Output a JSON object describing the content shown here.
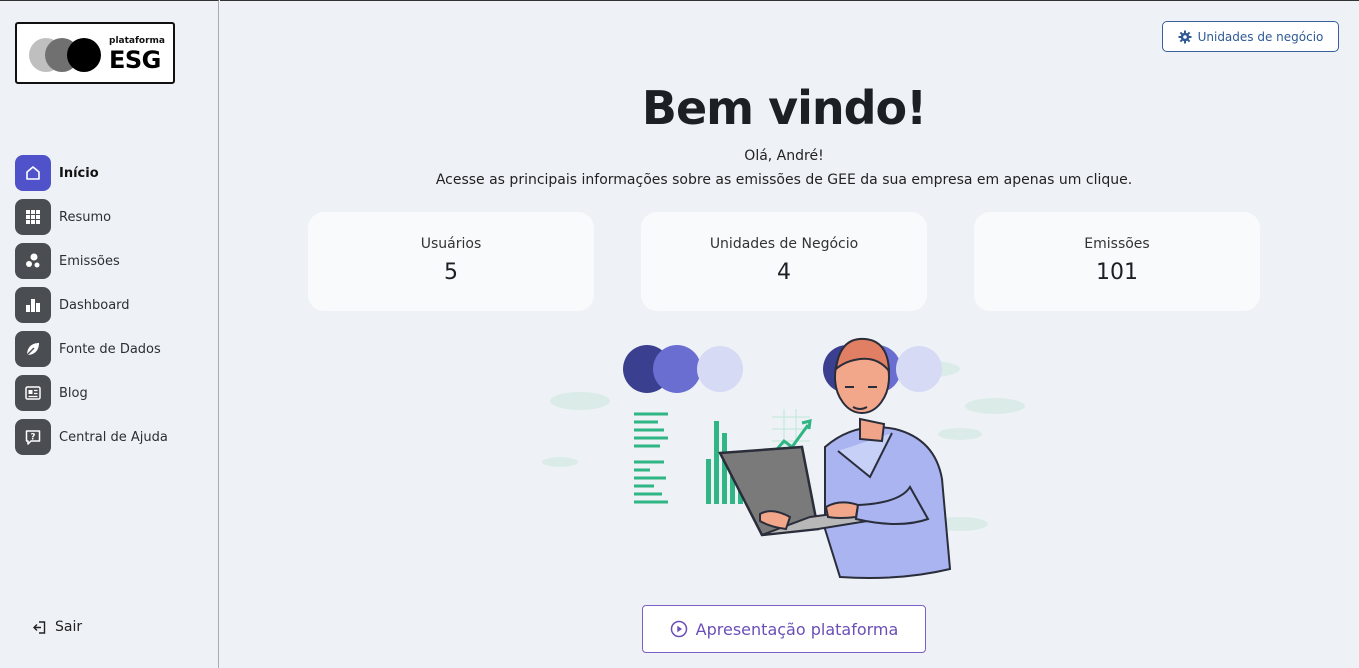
{
  "logo": {
    "small": "plataforma",
    "big": "ESG"
  },
  "nav": {
    "items": [
      {
        "label": "Início",
        "icon": "home-icon",
        "active": true
      },
      {
        "label": "Resumo",
        "icon": "grid-icon"
      },
      {
        "label": "Emissões",
        "icon": "bubbles-icon"
      },
      {
        "label": "Dashboard",
        "icon": "bar-chart-icon"
      },
      {
        "label": "Fonte de Dados",
        "icon": "leaf-icon"
      },
      {
        "label": "Blog",
        "icon": "newspaper-icon"
      },
      {
        "label": "Central de Ajuda",
        "icon": "help-icon"
      }
    ],
    "logout": "Sair"
  },
  "header": {
    "business_units_button": "Unidades de negócio"
  },
  "hero": {
    "title": "Bem vindo!",
    "greeting": "Olá, André!",
    "subtitle": "Acesse as principais informações sobre as emissões de GEE da sua empresa em apenas um clique."
  },
  "stats": [
    {
      "label": "Usuários",
      "value": "5"
    },
    {
      "label": "Unidades de Negócio",
      "value": "4"
    },
    {
      "label": "Emissões",
      "value": "101"
    }
  ],
  "presentation_button": "Apresentação plataforma",
  "colors": {
    "accent": "#4f52c9",
    "nav_icon_bg": "#4a4d52",
    "button_border": "#3a5f9a",
    "presentation": "#6a4fb6"
  }
}
